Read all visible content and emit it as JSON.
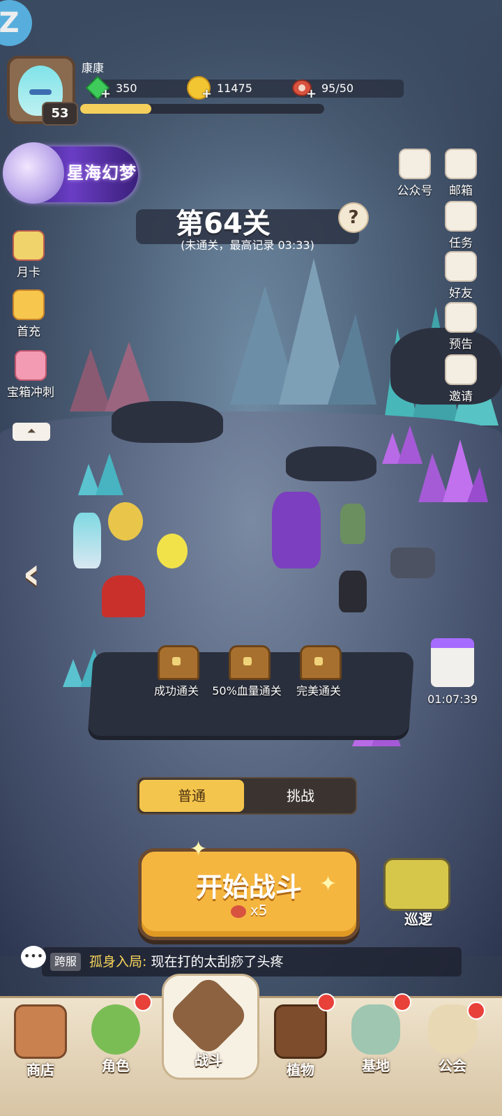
{
  "player": {
    "name": "康康",
    "level": "53",
    "xp_progress": 0.29
  },
  "resources": [
    {
      "icon": "green-gem-icon",
      "value": "350"
    },
    {
      "icon": "gold-coin-icon",
      "value": "11475"
    },
    {
      "icon": "meat-stamina-icon",
      "value": "95/50"
    }
  ],
  "event_banner": {
    "title": "星海幻梦"
  },
  "stage": {
    "title": "第64关",
    "subtitle": "(未通关，最高记录 03:33)",
    "help": "?"
  },
  "left_menu": [
    {
      "icon": "month-card-icon",
      "label": "月卡"
    },
    {
      "icon": "first-recharge-gift-icon",
      "label": "首充"
    },
    {
      "icon": "treasure-sprint-icon",
      "label": "宝箱冲刺"
    }
  ],
  "right_menu": [
    {
      "icon": "public-account-icon",
      "label": "公众号"
    },
    {
      "icon": "mailbox-icon",
      "label": "邮箱"
    },
    {
      "icon": "quest-icon",
      "label": "任务"
    },
    {
      "icon": "friends-icon",
      "label": "好友"
    },
    {
      "icon": "preview-icon",
      "label": "预告"
    },
    {
      "icon": "invite-icon",
      "label": "邀请"
    }
  ],
  "rewards": [
    {
      "icon": "chest-icon",
      "label": "成功通关"
    },
    {
      "icon": "chest-icon",
      "label": "50%血量通关"
    },
    {
      "icon": "chest-icon",
      "label": "完美通关"
    }
  ],
  "timer_gift": {
    "time": "01:07:39"
  },
  "modes": {
    "normal": "普通",
    "challenge": "挑战",
    "selected": "普通"
  },
  "start_button": {
    "label": "开始战斗",
    "cost": "x5"
  },
  "patrol": {
    "label": "巡逻"
  },
  "chat": {
    "tag": "跨服",
    "sender": "孤身入局:",
    "message": " 现在打的太刮痧了头疼"
  },
  "bottom_nav": [
    {
      "icon": "shop-icon",
      "label": "商店",
      "badge": false
    },
    {
      "icon": "character-icon",
      "label": "角色",
      "badge": true
    },
    {
      "icon": "battle-icon",
      "label": "战斗",
      "badge": false,
      "active": true
    },
    {
      "icon": "plant-book-icon",
      "label": "植物",
      "badge": true
    },
    {
      "icon": "base-island-icon",
      "label": "基地",
      "badge": true
    },
    {
      "icon": "guild-icon",
      "label": "公会",
      "badge": true
    }
  ],
  "colors": {
    "accent": "#f5b640",
    "badge": "#e8413a",
    "xp_fill": "#f4cf5b"
  }
}
